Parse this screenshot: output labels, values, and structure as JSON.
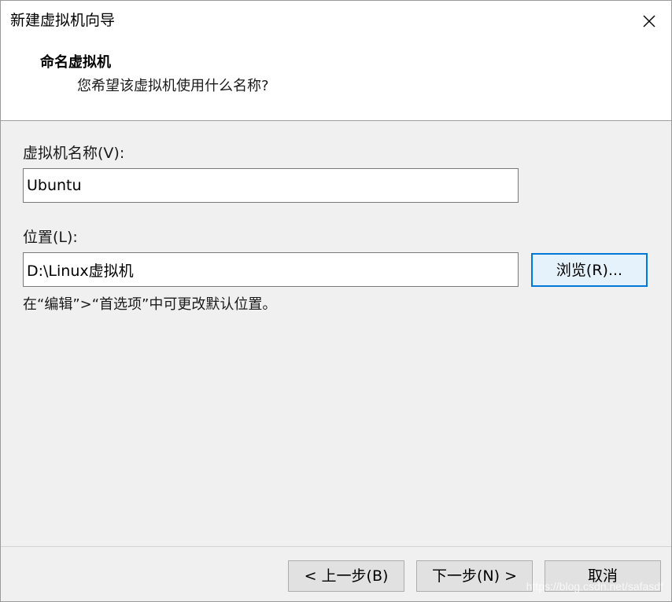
{
  "window": {
    "title": "新建虚拟机向导",
    "close_icon": "close-icon"
  },
  "header": {
    "title": "命名虚拟机",
    "subtitle": "您希望该虚拟机使用什么名称?"
  },
  "form": {
    "name_label": "虚拟机名称(V):",
    "name_value": "Ubuntu",
    "location_label": "位置(L):",
    "location_value": "D:\\Linux虚拟机",
    "browse_label": "浏览(R)...",
    "hint": "在“编辑”>“首选项”中可更改默认位置。"
  },
  "footer": {
    "back_label": "< 上一步(B)",
    "next_label": "下一步(N) >",
    "cancel_label": "取消",
    "watermark": "https://blog.csdn.net/safasdf"
  },
  "colors": {
    "accent": "#0078d7",
    "panel_bg": "#f0f0f0",
    "header_bg": "#ffffff",
    "button_bg": "#e1e1e1"
  }
}
